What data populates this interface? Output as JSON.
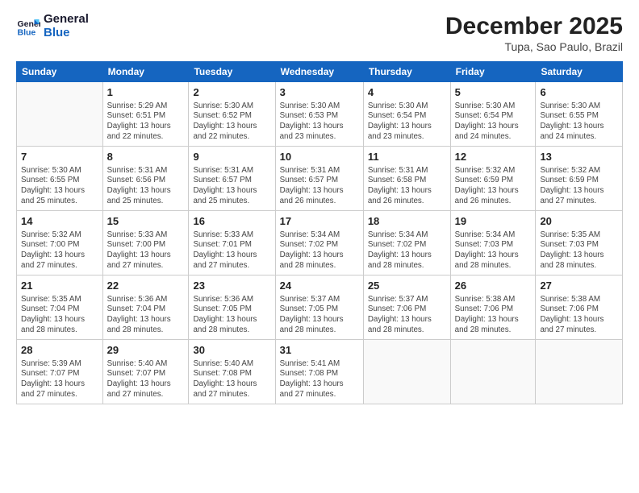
{
  "header": {
    "logo_line1": "General",
    "logo_line2": "Blue",
    "month": "December 2025",
    "location": "Tupa, Sao Paulo, Brazil"
  },
  "weekdays": [
    "Sunday",
    "Monday",
    "Tuesday",
    "Wednesday",
    "Thursday",
    "Friday",
    "Saturday"
  ],
  "weeks": [
    [
      {
        "day": "",
        "info": ""
      },
      {
        "day": "1",
        "info": "Sunrise: 5:29 AM\nSunset: 6:51 PM\nDaylight: 13 hours\nand 22 minutes."
      },
      {
        "day": "2",
        "info": "Sunrise: 5:30 AM\nSunset: 6:52 PM\nDaylight: 13 hours\nand 22 minutes."
      },
      {
        "day": "3",
        "info": "Sunrise: 5:30 AM\nSunset: 6:53 PM\nDaylight: 13 hours\nand 23 minutes."
      },
      {
        "day": "4",
        "info": "Sunrise: 5:30 AM\nSunset: 6:54 PM\nDaylight: 13 hours\nand 23 minutes."
      },
      {
        "day": "5",
        "info": "Sunrise: 5:30 AM\nSunset: 6:54 PM\nDaylight: 13 hours\nand 24 minutes."
      },
      {
        "day": "6",
        "info": "Sunrise: 5:30 AM\nSunset: 6:55 PM\nDaylight: 13 hours\nand 24 minutes."
      }
    ],
    [
      {
        "day": "7",
        "info": "Sunrise: 5:30 AM\nSunset: 6:55 PM\nDaylight: 13 hours\nand 25 minutes."
      },
      {
        "day": "8",
        "info": "Sunrise: 5:31 AM\nSunset: 6:56 PM\nDaylight: 13 hours\nand 25 minutes."
      },
      {
        "day": "9",
        "info": "Sunrise: 5:31 AM\nSunset: 6:57 PM\nDaylight: 13 hours\nand 25 minutes."
      },
      {
        "day": "10",
        "info": "Sunrise: 5:31 AM\nSunset: 6:57 PM\nDaylight: 13 hours\nand 26 minutes."
      },
      {
        "day": "11",
        "info": "Sunrise: 5:31 AM\nSunset: 6:58 PM\nDaylight: 13 hours\nand 26 minutes."
      },
      {
        "day": "12",
        "info": "Sunrise: 5:32 AM\nSunset: 6:59 PM\nDaylight: 13 hours\nand 26 minutes."
      },
      {
        "day": "13",
        "info": "Sunrise: 5:32 AM\nSunset: 6:59 PM\nDaylight: 13 hours\nand 27 minutes."
      }
    ],
    [
      {
        "day": "14",
        "info": "Sunrise: 5:32 AM\nSunset: 7:00 PM\nDaylight: 13 hours\nand 27 minutes."
      },
      {
        "day": "15",
        "info": "Sunrise: 5:33 AM\nSunset: 7:00 PM\nDaylight: 13 hours\nand 27 minutes."
      },
      {
        "day": "16",
        "info": "Sunrise: 5:33 AM\nSunset: 7:01 PM\nDaylight: 13 hours\nand 27 minutes."
      },
      {
        "day": "17",
        "info": "Sunrise: 5:34 AM\nSunset: 7:02 PM\nDaylight: 13 hours\nand 28 minutes."
      },
      {
        "day": "18",
        "info": "Sunrise: 5:34 AM\nSunset: 7:02 PM\nDaylight: 13 hours\nand 28 minutes."
      },
      {
        "day": "19",
        "info": "Sunrise: 5:34 AM\nSunset: 7:03 PM\nDaylight: 13 hours\nand 28 minutes."
      },
      {
        "day": "20",
        "info": "Sunrise: 5:35 AM\nSunset: 7:03 PM\nDaylight: 13 hours\nand 28 minutes."
      }
    ],
    [
      {
        "day": "21",
        "info": "Sunrise: 5:35 AM\nSunset: 7:04 PM\nDaylight: 13 hours\nand 28 minutes."
      },
      {
        "day": "22",
        "info": "Sunrise: 5:36 AM\nSunset: 7:04 PM\nDaylight: 13 hours\nand 28 minutes."
      },
      {
        "day": "23",
        "info": "Sunrise: 5:36 AM\nSunset: 7:05 PM\nDaylight: 13 hours\nand 28 minutes."
      },
      {
        "day": "24",
        "info": "Sunrise: 5:37 AM\nSunset: 7:05 PM\nDaylight: 13 hours\nand 28 minutes."
      },
      {
        "day": "25",
        "info": "Sunrise: 5:37 AM\nSunset: 7:06 PM\nDaylight: 13 hours\nand 28 minutes."
      },
      {
        "day": "26",
        "info": "Sunrise: 5:38 AM\nSunset: 7:06 PM\nDaylight: 13 hours\nand 28 minutes."
      },
      {
        "day": "27",
        "info": "Sunrise: 5:38 AM\nSunset: 7:06 PM\nDaylight: 13 hours\nand 27 minutes."
      }
    ],
    [
      {
        "day": "28",
        "info": "Sunrise: 5:39 AM\nSunset: 7:07 PM\nDaylight: 13 hours\nand 27 minutes."
      },
      {
        "day": "29",
        "info": "Sunrise: 5:40 AM\nSunset: 7:07 PM\nDaylight: 13 hours\nand 27 minutes."
      },
      {
        "day": "30",
        "info": "Sunrise: 5:40 AM\nSunset: 7:08 PM\nDaylight: 13 hours\nand 27 minutes."
      },
      {
        "day": "31",
        "info": "Sunrise: 5:41 AM\nSunset: 7:08 PM\nDaylight: 13 hours\nand 27 minutes."
      },
      {
        "day": "",
        "info": ""
      },
      {
        "day": "",
        "info": ""
      },
      {
        "day": "",
        "info": ""
      }
    ]
  ]
}
